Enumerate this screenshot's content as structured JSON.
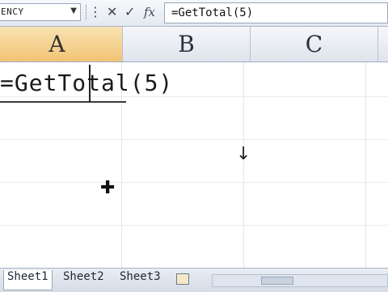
{
  "name_box": {
    "value": "ENCY",
    "dropdown_icon": "chevron-down-icon"
  },
  "formula_bar": {
    "buttons": {
      "cancel": "✕",
      "enter": "✓",
      "fx": "fx"
    },
    "value": "=GetTotal(5)"
  },
  "columns": [
    {
      "label": "A",
      "selected": true
    },
    {
      "label": "B",
      "selected": false
    },
    {
      "label": "C",
      "selected": false
    }
  ],
  "cell_a1": {
    "value": "=GetTotal(5)"
  },
  "cursors": {
    "arrow": "↓",
    "plus": "✚"
  },
  "sheets": [
    "Sheet1",
    "Sheet2",
    "Sheet3"
  ],
  "colors": {
    "selected_header": "#f2c474",
    "grid_line": "#e6e6e6"
  }
}
